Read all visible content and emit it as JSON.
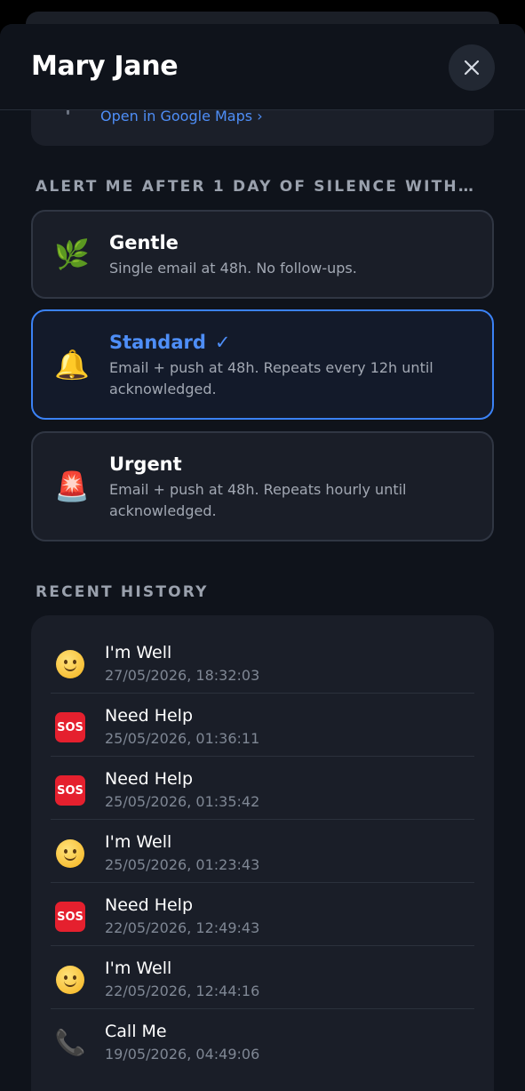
{
  "header": {
    "title": "Mary Jane"
  },
  "location": {
    "maps_link": "Open in Google Maps ›"
  },
  "alert_section": {
    "label": "ALERT ME AFTER 1 DAY OF SILENCE WITH…",
    "selected": "Standard",
    "options": [
      {
        "title": "Gentle",
        "description": "Single email at 48h. No follow-ups.",
        "icon": "herb-icon",
        "emoji": "🌿"
      },
      {
        "title": "Standard",
        "check": "✓",
        "description": "Email + push at 48h. Repeats every 12h until acknowledged.",
        "icon": "bell-icon",
        "emoji": "🔔"
      },
      {
        "title": "Urgent",
        "description": "Email + push at 48h. Repeats hourly until acknowledged.",
        "icon": "siren-icon",
        "emoji": "🚨"
      }
    ]
  },
  "history": {
    "label": "RECENT HISTORY",
    "items": [
      {
        "title": "I'm Well",
        "time": "27/05/2026, 18:32:03",
        "icon": "smile-icon"
      },
      {
        "title": "Need Help",
        "time": "25/05/2026, 01:36:11",
        "icon": "sos-icon",
        "badge": "SOS"
      },
      {
        "title": "Need Help",
        "time": "25/05/2026, 01:35:42",
        "icon": "sos-icon",
        "badge": "SOS"
      },
      {
        "title": "I'm Well",
        "time": "25/05/2026, 01:23:43",
        "icon": "smile-icon"
      },
      {
        "title": "Need Help",
        "time": "22/05/2026, 12:49:43",
        "icon": "sos-icon",
        "badge": "SOS"
      },
      {
        "title": "I'm Well",
        "time": "22/05/2026, 12:44:16",
        "icon": "smile-icon"
      },
      {
        "title": "Call Me",
        "time": "19/05/2026, 04:49:06",
        "icon": "phone-icon",
        "glyph": "📞"
      }
    ]
  },
  "colors": {
    "accent": "#3b82f6",
    "background": "#0f131b",
    "card": "#1a1e28",
    "sos": "#e5202e"
  }
}
